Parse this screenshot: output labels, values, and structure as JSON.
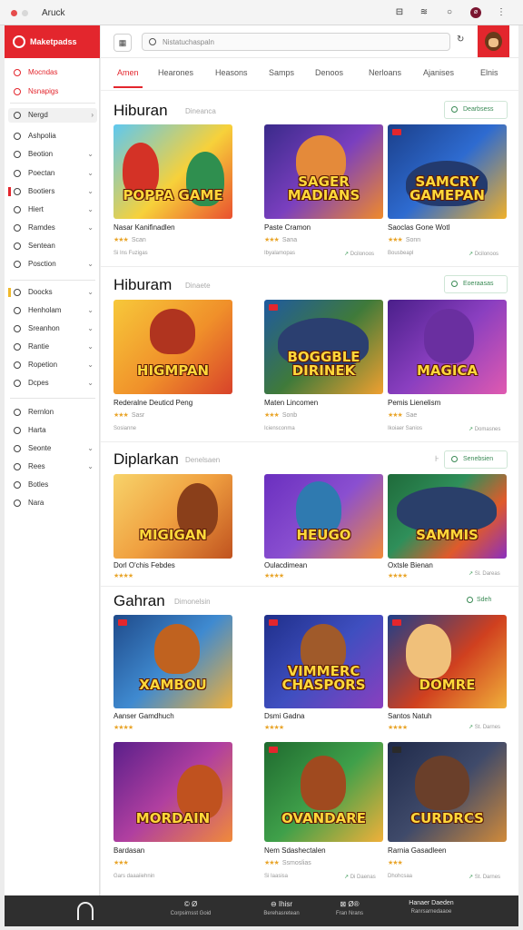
{
  "window": {
    "title": "Aruck"
  },
  "brand": {
    "name": "Maketpadss"
  },
  "sidebar": {
    "items": [
      {
        "label": "Mocndas",
        "chevron": ""
      },
      {
        "label": "Nsnapigs",
        "chevron": ""
      },
      {
        "label": "Nergd",
        "chevron": "›"
      },
      {
        "label": "Ashpolia",
        "chevron": ""
      },
      {
        "label": "Beotion",
        "chevron": "⌄"
      },
      {
        "label": "Poectan",
        "chevron": "⌄"
      },
      {
        "label": "Bootiers",
        "chevron": "⌄"
      },
      {
        "label": "Hiert",
        "chevron": "⌄"
      },
      {
        "label": "Ramdes",
        "chevron": "⌄"
      },
      {
        "label": "Sentean",
        "chevron": ""
      },
      {
        "label": "Posction",
        "chevron": "⌄"
      },
      {
        "label": "Doocks",
        "chevron": "⌄"
      },
      {
        "label": "Henholam",
        "chevron": "⌄"
      },
      {
        "label": "Sreanhon",
        "chevron": "⌄"
      },
      {
        "label": "Rantie",
        "chevron": "⌄"
      },
      {
        "label": "Ropetion",
        "chevron": "⌄"
      },
      {
        "label": "Dcpes",
        "chevron": "⌄"
      },
      {
        "label": "Rernlon",
        "chevron": ""
      },
      {
        "label": "Harta",
        "chevron": ""
      },
      {
        "label": "Seonte",
        "chevron": "⌄"
      },
      {
        "label": "Rees",
        "chevron": "⌄"
      },
      {
        "label": "Botles",
        "chevron": ""
      },
      {
        "label": "Nara",
        "chevron": ""
      }
    ]
  },
  "search": {
    "placeholder": "Nistatuchaspaln"
  },
  "tabs": [
    "Amen",
    "Hearones",
    "Heasons",
    "Samps",
    "Denoos",
    "Nerloans",
    "Ajanises",
    "Elnis"
  ],
  "sections": [
    {
      "title": "Hiburan",
      "subtitle": "Dineanca",
      "see_all": "Dearbsess",
      "cards": [
        {
          "art": "POPPA GAME",
          "title": "Nasar Kanifinadlen",
          "meta": "Scan",
          "extra": "Si Ins Fuzigas"
        },
        {
          "art": "SAGER MADIANS",
          "title": "Paste Cramon",
          "meta": "Sana",
          "extra": "Ibyalamopas"
        },
        {
          "art": "SAMCRY GAMEPAN",
          "title": "Saoclas Gone Wotl",
          "meta": "Sonn",
          "extra": "Bousbeapl"
        }
      ],
      "extra_right": "Dcilonoos"
    },
    {
      "title": "Hiburam",
      "subtitle": "Dinaete",
      "see_all": "Eoeraasas",
      "cards": [
        {
          "art": "HIGMPAN",
          "title": "Rederalne Deuticd Peng",
          "meta": "Sasr",
          "extra": "Sosianne"
        },
        {
          "art": "BOGGBLE DIRINEK",
          "title": "Maten Lincomen",
          "meta": "Sonb",
          "extra": "Iciensconma"
        },
        {
          "art": "MAGICA",
          "title": "Pemis Lienelism",
          "meta": "Sae",
          "extra": "Ikoiaer Sanios"
        }
      ],
      "extra_right": "Domasnes"
    },
    {
      "title": "Diplarkan",
      "subtitle": "Denelsaen",
      "see_all": "Senebsien",
      "cards": [
        {
          "art": "MIGIGAN",
          "title": "Dorl O'chis Febdes",
          "meta": "",
          "extra": ""
        },
        {
          "art": "HEUGO",
          "title": "Oulacdimean",
          "meta": "",
          "extra": ""
        },
        {
          "art": "SAMMIS",
          "title": "Oxtsle Bienan",
          "meta": "",
          "extra": ""
        }
      ],
      "extra_right": "Sl. Dareas"
    },
    {
      "title": "Gahran",
      "subtitle": "Dimonelsin",
      "see_all": "Sdeh",
      "cards": [
        {
          "art": "XAMBOU",
          "title": "Aanser Gamdhuch",
          "meta": "",
          "extra": ""
        },
        {
          "art": "VIMMERC CHASPORS",
          "title": "Dsmi Gadna",
          "meta": "",
          "extra": ""
        },
        {
          "art": "DOMRE",
          "title": "Santos Natuh",
          "meta": "",
          "extra": ""
        },
        {
          "art": "MORDAIN",
          "title": "Bardasan",
          "meta": "Gars daaaiiehnin",
          "extra": ""
        },
        {
          "art": "OVANDARE",
          "title": "Nem Sdashectalen",
          "meta": "Ssmoslias",
          "extra": "Si Iaasisa"
        },
        {
          "art": "CURDRCS",
          "title": "Rarnia Gasadleen",
          "meta": "Dhohcsaa",
          "extra": ""
        }
      ],
      "extra_right": "St. Darnes",
      "extra_right_2": "Di Daenas"
    }
  ],
  "bottombar": {
    "groups": [
      {
        "top": "© Ø",
        "bottom": "Corpsirnsst Goid"
      },
      {
        "top": "⊖ Ihisr",
        "bottom": "Berehasretean"
      },
      {
        "top": "⊠ Ø®",
        "bottom": "Fran Nrans"
      },
      {
        "top": "Hanaer Daeden",
        "bottom": "Ranrsarnedaaoe"
      }
    ]
  },
  "colors": {
    "accent": "#e3262d",
    "green": "#3a8a55",
    "star": "#e9a52a"
  }
}
